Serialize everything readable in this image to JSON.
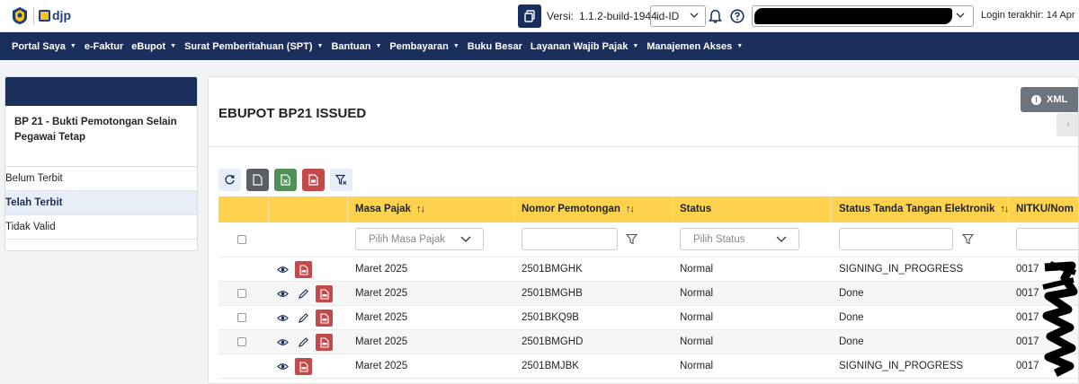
{
  "header": {
    "logo_text": "djp",
    "version_label": "Versi:",
    "version_value": "1.1.2-build-1944",
    "language": "id-ID",
    "last_login": "Login terakhir:  14 Apr"
  },
  "nav": [
    {
      "label": "Portal Saya",
      "dropdown": true
    },
    {
      "label": "e-Faktur",
      "dropdown": false
    },
    {
      "label": "eBupot",
      "dropdown": true
    },
    {
      "label": "Surat Pemberitahuan (SPT)",
      "dropdown": true
    },
    {
      "label": "Bantuan",
      "dropdown": true
    },
    {
      "label": "Pembayaran",
      "dropdown": true
    },
    {
      "label": "Buku Besar",
      "dropdown": false
    },
    {
      "label": "Layanan Wajib Pajak",
      "dropdown": true
    },
    {
      "label": "Manajemen Akses",
      "dropdown": true
    }
  ],
  "sidebar": {
    "title": "BP 21 - Bukti Pemotongan Selain Pegawai Tetap",
    "links": [
      {
        "label": "Belum Terbit",
        "active": false
      },
      {
        "label": "Telah Terbit",
        "active": true
      },
      {
        "label": "Tidak Valid",
        "active": false
      }
    ]
  },
  "main": {
    "title": "EBUPOT BP21 ISSUED",
    "xml_button": "XML"
  },
  "table": {
    "headers": {
      "masa_pajak": "Masa Pajak",
      "nomor_pemotongan": "Nomor Pemotongan",
      "status": "Status",
      "status_ttd": "Status Tanda Tangan Elektronik",
      "nitku": "NITKU/Nom"
    },
    "filters": {
      "masa_pajak_placeholder": "Pilih Masa Pajak",
      "status_placeholder": "Pilih Status"
    },
    "rows": [
      {
        "masa": "Maret 2025",
        "nomor": "2501BMGHK",
        "status": "Normal",
        "ttd": "SIGNING_IN_PROGRESS",
        "nitku": "0017",
        "checkbox": false,
        "editable": false
      },
      {
        "masa": "Maret 2025",
        "nomor": "2501BMGHB",
        "status": "Normal",
        "ttd": "Done",
        "nitku": "0017",
        "checkbox": true,
        "editable": true
      },
      {
        "masa": "Maret 2025",
        "nomor": "2501BKQ9B",
        "status": "Normal",
        "ttd": "Done",
        "nitku": "0017",
        "checkbox": true,
        "editable": true
      },
      {
        "masa": "Maret 2025",
        "nomor": "2501BMGHD",
        "status": "Normal",
        "ttd": "Done",
        "nitku": "0017",
        "checkbox": true,
        "editable": true
      },
      {
        "masa": "Maret 2025",
        "nomor": "2501BMJBK",
        "status": "Normal",
        "ttd": "SIGNING_IN_PROGRESS",
        "nitku": "0017",
        "checkbox": false,
        "editable": false
      }
    ]
  },
  "colors": {
    "navy": "#1b2f5c",
    "table_header": "#ffd24d",
    "pdf_red": "#c24a4a",
    "excel_green": "#4f9158"
  }
}
